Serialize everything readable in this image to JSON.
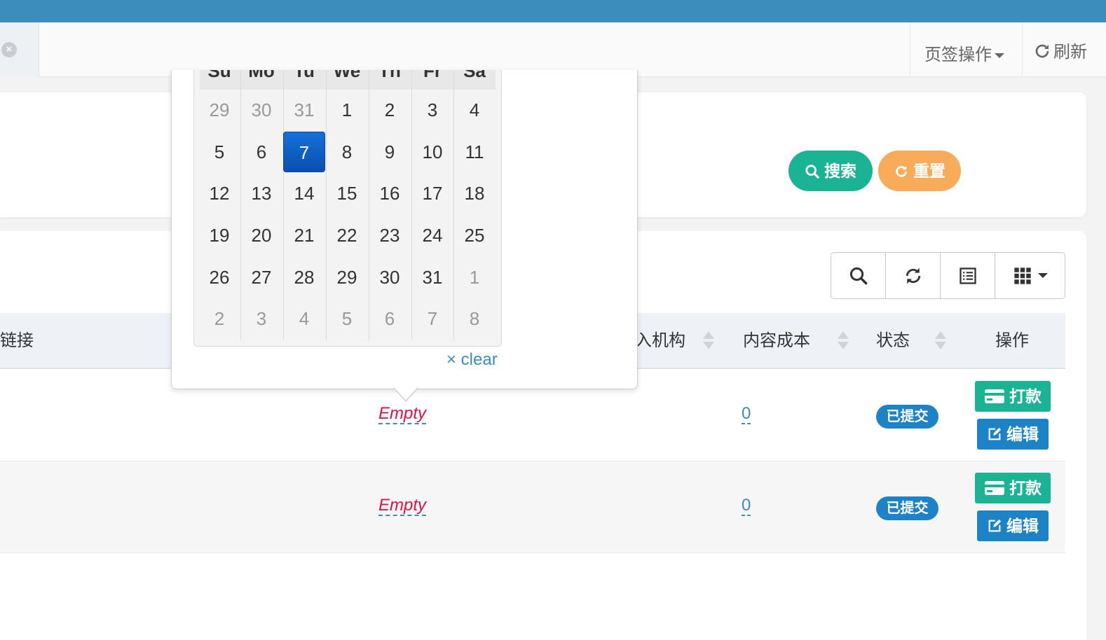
{
  "tabbar": {
    "close_glyph": "×",
    "page_ops_label": "页签操作",
    "refresh_label": "刷新"
  },
  "search_panel": {
    "search_label": "搜索",
    "reset_label": "重置"
  },
  "table": {
    "columns": [
      {
        "key": "link",
        "label": "链接"
      },
      {
        "key": "org",
        "label": "入机构"
      },
      {
        "key": "cost",
        "label": "内容成本"
      },
      {
        "key": "status",
        "label": "状态"
      },
      {
        "key": "actions",
        "label": "操作"
      }
    ],
    "rows": [
      {
        "editable": "Empty",
        "cost": "0",
        "status": "已提交",
        "pay_label": "打款",
        "edit_label": "编辑"
      },
      {
        "editable": "Empty",
        "cost": "0",
        "status": "已提交",
        "pay_label": "打款",
        "edit_label": "编辑"
      }
    ]
  },
  "datepicker": {
    "weekdays": [
      "Su",
      "Mo",
      "Tu",
      "We",
      "Th",
      "Fr",
      "Sa"
    ],
    "weeks": [
      [
        {
          "d": "29",
          "muted": true
        },
        {
          "d": "30",
          "muted": true
        },
        {
          "d": "31",
          "muted": true
        },
        {
          "d": "1"
        },
        {
          "d": "2"
        },
        {
          "d": "3"
        },
        {
          "d": "4"
        }
      ],
      [
        {
          "d": "5"
        },
        {
          "d": "6"
        },
        {
          "d": "7",
          "active": true
        },
        {
          "d": "8"
        },
        {
          "d": "9"
        },
        {
          "d": "10"
        },
        {
          "d": "11"
        }
      ],
      [
        {
          "d": "12"
        },
        {
          "d": "13"
        },
        {
          "d": "14"
        },
        {
          "d": "15"
        },
        {
          "d": "16"
        },
        {
          "d": "17"
        },
        {
          "d": "18"
        }
      ],
      [
        {
          "d": "19"
        },
        {
          "d": "20"
        },
        {
          "d": "21"
        },
        {
          "d": "22"
        },
        {
          "d": "23"
        },
        {
          "d": "24"
        },
        {
          "d": "25"
        }
      ],
      [
        {
          "d": "26"
        },
        {
          "d": "27"
        },
        {
          "d": "28"
        },
        {
          "d": "29"
        },
        {
          "d": "30"
        },
        {
          "d": "31"
        },
        {
          "d": "1",
          "muted": true
        }
      ],
      [
        {
          "d": "2",
          "muted": true
        },
        {
          "d": "3",
          "muted": true
        },
        {
          "d": "4",
          "muted": true
        },
        {
          "d": "5",
          "muted": true
        },
        {
          "d": "6",
          "muted": true
        },
        {
          "d": "7",
          "muted": true
        },
        {
          "d": "8",
          "muted": true
        }
      ]
    ],
    "clear_label": "× clear"
  },
  "colors": {
    "topbar": "#3c8dbc",
    "primary_green": "#1ab394",
    "warning_orange": "#f8ac59",
    "info_blue": "#1c84c6",
    "editable_empty": "#dd1144"
  },
  "icons": {
    "tab_close": "close-circle-icon",
    "page_ops": "caret-down-icon",
    "refresh": "refresh-icon",
    "search": "search-icon",
    "reset": "refresh-icon",
    "toolbar": [
      "search-icon",
      "refresh-icon",
      "list-icon",
      "grid-icon"
    ],
    "pay": "credit-card-icon",
    "edit": "edit-icon"
  }
}
